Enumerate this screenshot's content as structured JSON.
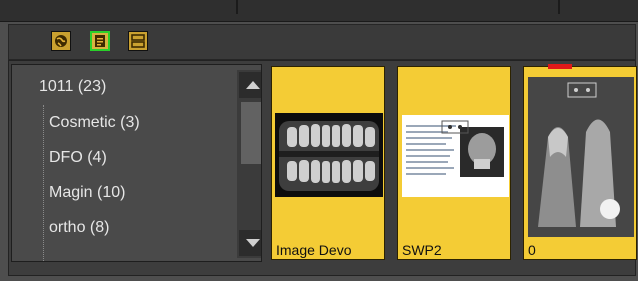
{
  "toolbar": {
    "buttons": [
      {
        "icon": "globe-icon"
      },
      {
        "icon": "document-icon",
        "active": true
      },
      {
        "icon": "stack-icon"
      }
    ]
  },
  "tree": {
    "items": [
      {
        "label": "1011 (23)"
      },
      {
        "label": "Cosmetic (3)"
      },
      {
        "label": "DFO (4)"
      },
      {
        "label": "Magin (10)"
      },
      {
        "label": "ortho (8)"
      }
    ]
  },
  "images": [
    {
      "label": "Image Devo"
    },
    {
      "label": "SWP2"
    },
    {
      "label": "0"
    }
  ],
  "colors": {
    "card_bg": "#f4cc35",
    "toolbar_active_border": "#29d12a",
    "selected_marker": "#e01919"
  }
}
